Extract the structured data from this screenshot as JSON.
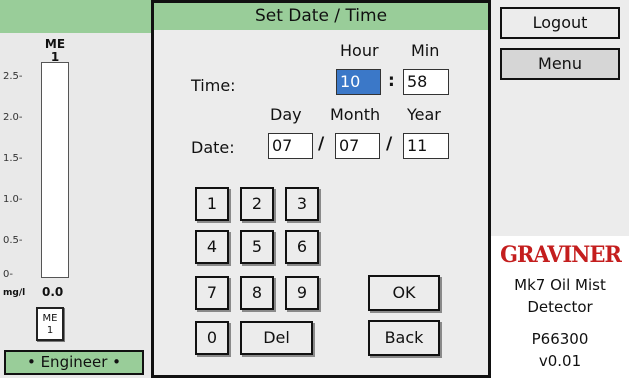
{
  "left_panel": {
    "channel_name": "ME",
    "channel_number": "1",
    "scale_ticks": [
      "2.5-",
      "2.0-",
      "1.5-",
      "1.0-",
      "0.5-",
      "0-"
    ],
    "unit": "mg/l",
    "reading": "0.0",
    "channel_button": {
      "line1": "ME",
      "line2": "1"
    },
    "access_level": "• Engineer •"
  },
  "dialog": {
    "title": "Set Date / Time",
    "time_label": "Time:",
    "date_label": "Date:",
    "hour_header": "Hour",
    "min_header": "Min",
    "day_header": "Day",
    "month_header": "Month",
    "year_header": "Year",
    "hour_value": "10",
    "min_value": "58",
    "day_value": "07",
    "month_value": "07",
    "year_value": "11",
    "time_separator": ":",
    "date_separator": "/",
    "keypad": {
      "k1": "1",
      "k2": "2",
      "k3": "3",
      "k4": "4",
      "k5": "5",
      "k6": "6",
      "k7": "7",
      "k8": "8",
      "k9": "9",
      "k0": "0",
      "del": "Del",
      "ok": "OK",
      "back": "Back"
    }
  },
  "right_panel": {
    "logout_label": "Logout",
    "menu_label": "Menu",
    "logo_text": "GRAVINER",
    "product_line1": "Mk7 Oil Mist",
    "product_line2": "Detector",
    "part_number": "P66300",
    "version": "v0.01"
  },
  "colors": {
    "header_green": "#99cd99",
    "selection_blue": "#3b78c8",
    "logo_red": "#c41e1e"
  }
}
